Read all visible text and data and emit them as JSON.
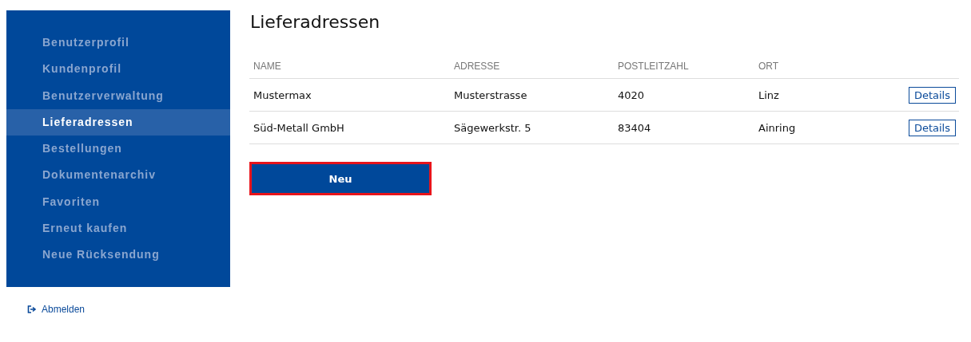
{
  "sidebar": {
    "items": [
      {
        "label": "Benutzerprofil",
        "selected": false
      },
      {
        "label": "Kundenprofil",
        "selected": false
      },
      {
        "label": "Benutzerverwaltung",
        "selected": false
      },
      {
        "label": "Lieferadressen",
        "selected": true
      },
      {
        "label": "Bestellungen",
        "selected": false
      },
      {
        "label": "Dokumentenarchiv",
        "selected": false
      },
      {
        "label": "Favoriten",
        "selected": false
      },
      {
        "label": "Erneut kaufen",
        "selected": false
      },
      {
        "label": "Neue Rücksendung",
        "selected": false
      }
    ],
    "logout": "Abmelden"
  },
  "page_title": "Lieferadressen",
  "table": {
    "columns": [
      "NAME",
      "ADRESSE",
      "POSTLEITZAHL",
      "ORT"
    ],
    "rows": [
      {
        "cells": [
          "Mustermax",
          "Musterstrasse",
          "4020",
          "Linz"
        ],
        "action": "Details"
      },
      {
        "cells": [
          "Süd-Metall GmbH",
          "Sägewerkstr. 5",
          "83404",
          "Ainring"
        ],
        "action": "Details"
      }
    ]
  },
  "new_button": {
    "label": "Neu",
    "highlighted": true
  }
}
